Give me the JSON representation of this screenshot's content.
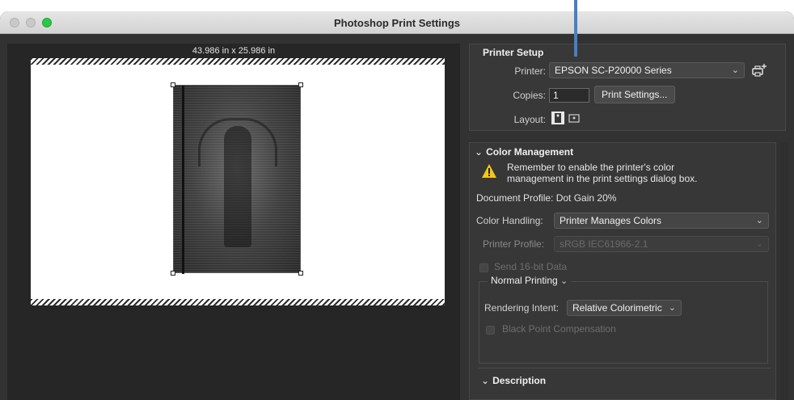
{
  "window": {
    "title": "Photoshop Print Settings"
  },
  "preview": {
    "dimensions": "43.986 in x 25.986 in"
  },
  "printer_setup": {
    "title": "Printer Setup",
    "printer_label": "Printer:",
    "printer_value": "EPSON SC-P20000 Series",
    "copies_label": "Copies:",
    "copies_value": "1",
    "print_settings_button": "Print Settings...",
    "layout_label": "Layout:"
  },
  "color_management": {
    "title": "Color Management",
    "warning_line1": "Remember to enable the printer's color",
    "warning_line2": "management in the print settings dialog box.",
    "document_profile": "Document Profile: Dot Gain 20%",
    "color_handling_label": "Color Handling:",
    "color_handling_value": "Printer Manages Colors",
    "printer_profile_label": "Printer Profile:",
    "printer_profile_value": "sRGB IEC61966-2.1",
    "send_16bit_label": "Send 16-bit Data",
    "normal_printing_label": "Normal Printing",
    "rendering_intent_label": "Rendering Intent:",
    "rendering_intent_value": "Relative Colorimetric",
    "black_point_label": "Black Point Compensation"
  },
  "description": {
    "title": "Description"
  },
  "colors": {
    "accent_line": "#4a7fc1",
    "window_bg": "#323232",
    "warning_yellow": "#f5c518"
  }
}
